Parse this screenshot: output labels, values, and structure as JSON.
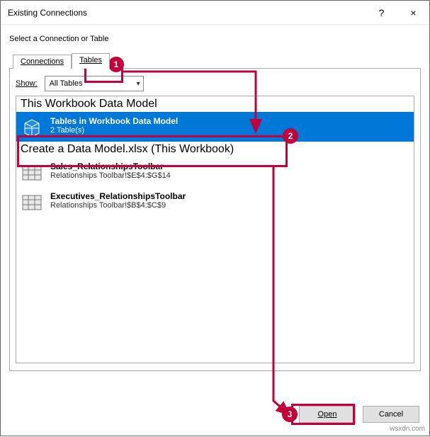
{
  "titlebar": {
    "title": "Existing Connections",
    "help": "?",
    "close": "×"
  },
  "prompt": "Select a Connection or Table",
  "tabs": {
    "connections": "Connections",
    "tables": "Tables"
  },
  "show": {
    "label": "Show:",
    "selected": "All Tables"
  },
  "list": {
    "group1": {
      "header": "This Workbook Data Model"
    },
    "item1": {
      "title": "Tables in Workbook Data Model",
      "subtitle": "2 Table(s)"
    },
    "group2": {
      "header": "Create a Data Model.xlsx (This Workbook)"
    },
    "item2": {
      "title": "Sales_RelationshipsToolbar",
      "subtitle": "Relationships Toolbar!$E$4:$G$14"
    },
    "item3": {
      "title": "Executives_RelationshipsToolbar",
      "subtitle": "Relationships Toolbar!$B$4:$C$9"
    }
  },
  "buttons": {
    "open": "Open",
    "cancel": "Cancel"
  },
  "badges": {
    "b1": "1",
    "b2": "2",
    "b3": "3"
  },
  "watermark": "wsxdn.com"
}
